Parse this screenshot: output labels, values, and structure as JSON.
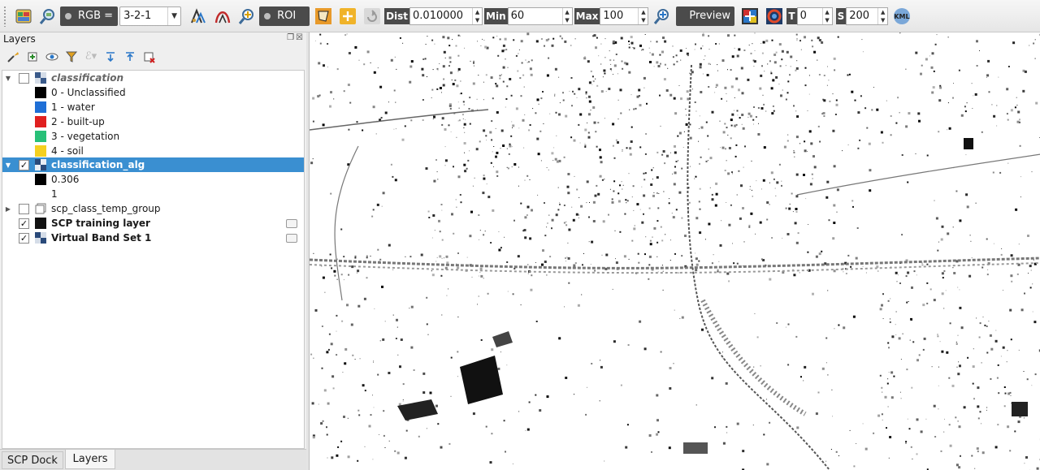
{
  "toolbar": {
    "rgb_label": "RGB =",
    "rgb_value": "3-2-1",
    "roi_label": "ROI",
    "dist_label": "Dist",
    "dist_value": "0.010000",
    "min_label": "Min",
    "min_value": "60",
    "max_label": "Max",
    "max_value": "100",
    "preview_label": "Preview",
    "t_label": "T",
    "t_value": "0",
    "s_label": "S",
    "s_value": "200",
    "kml_label": "KML"
  },
  "panel": {
    "title": "Layers"
  },
  "layers": {
    "classification": "classification",
    "classes": [
      {
        "label": "0 - Unclassified",
        "color": "#000000"
      },
      {
        "label": "1 - water",
        "color": "#1f6fd6"
      },
      {
        "label": "2 - built-up",
        "color": "#e02020"
      },
      {
        "label": "3 - vegetation",
        "color": "#28c078"
      },
      {
        "label": "4 - soil",
        "color": "#f5d020"
      }
    ],
    "classification_alg": "classification_alg",
    "alg_min": "0.306",
    "alg_max": "1",
    "temp_group": "scp_class_temp_group",
    "training_layer": "SCP training layer",
    "band_set": "Virtual Band Set 1"
  },
  "tabs": {
    "scp_dock": "SCP Dock",
    "layers": "Layers"
  },
  "colors": {
    "selection": "#3a8fd1",
    "toolbar_dark": "#4b4b4b"
  }
}
